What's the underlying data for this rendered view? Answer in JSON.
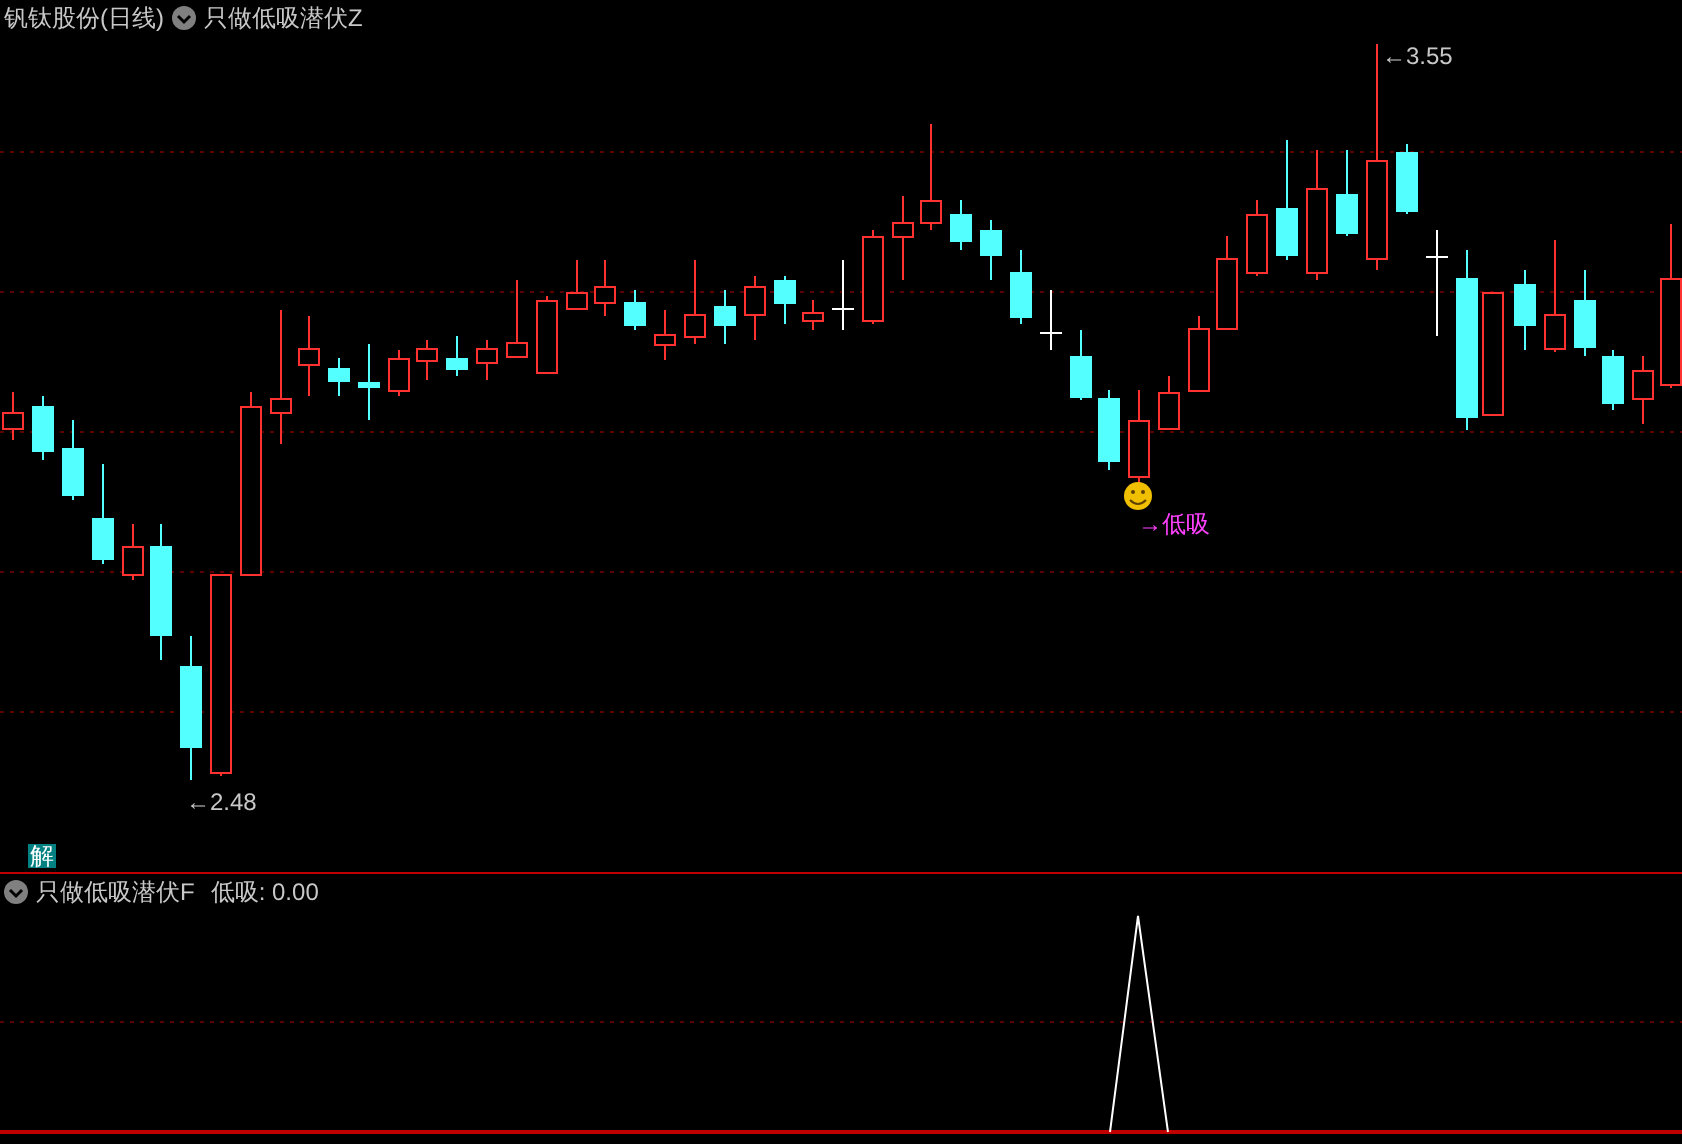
{
  "main_panel": {
    "stock_title": "钒钛股份(日线)",
    "indicator_name": "只做低吸潜伏Z",
    "high_label": "←3.55",
    "low_label": "←2.48",
    "signal_label": "→低吸",
    "badge": "解"
  },
  "sub_panel": {
    "indicator_name": "只做低吸潜伏F",
    "reading": "低吸: 0.00"
  }
}
